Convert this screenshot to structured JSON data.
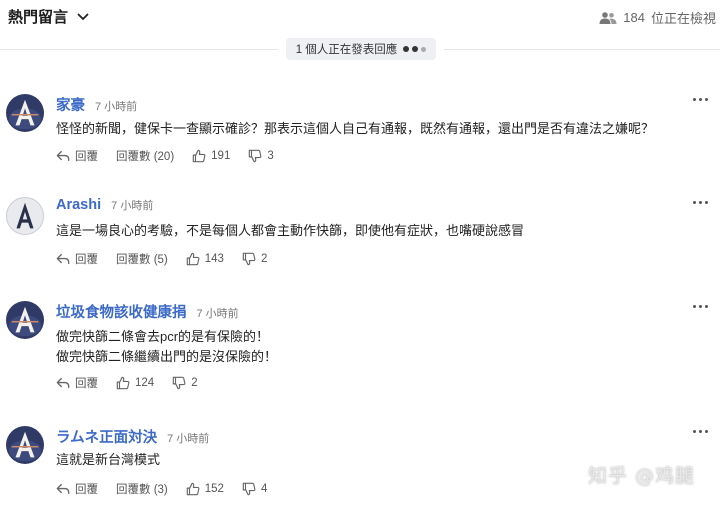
{
  "header": {
    "sort_label": "熱門留言",
    "viewer_count": "184",
    "viewer_text": "位正在檢視"
  },
  "typing": {
    "text": "1 個人正在發表回應"
  },
  "comments": [
    {
      "author": "家豪",
      "time": "7 小時前",
      "lines": [
        "怪怪的新聞，健保卡一查顯示確診？那表示這個人自己有通報，既然有通報，還出門是否有違法之嫌呢？"
      ],
      "reply_label": "回覆",
      "replies_label": "回覆數 (20)",
      "likes": "191",
      "dislikes": "3"
    },
    {
      "author": "Arashi",
      "time": "7 小時前",
      "lines": [
        "這是一場良心的考驗，不是每個人都會主動作快篩，即使他有症狀，也嘴硬說感冒"
      ],
      "reply_label": "回覆",
      "replies_label": "回覆數 (5)",
      "likes": "143",
      "dislikes": "2"
    },
    {
      "author": "垃圾食物該收健康捐",
      "time": "7 小時前",
      "lines": [
        "做完快篩二條會去pcr的是有保險的！",
        "做完快篩二條繼續出門的是沒保險的！"
      ],
      "reply_label": "回覆",
      "likes": "124",
      "dislikes": "2"
    },
    {
      "author": "ラムネ正面対決",
      "time": "7 小時前",
      "lines": [
        "這就是新台灣模式"
      ],
      "reply_label": "回覆",
      "replies_label": "回覆數 (3)",
      "likes": "152",
      "dislikes": "4"
    }
  ],
  "watermark": {
    "text": "知乎 @鸡腿"
  },
  "colors": {
    "author": "#3c6ac8",
    "avatar_bg": "#2f3a66",
    "avatar_letter": "#f4f1ea"
  }
}
